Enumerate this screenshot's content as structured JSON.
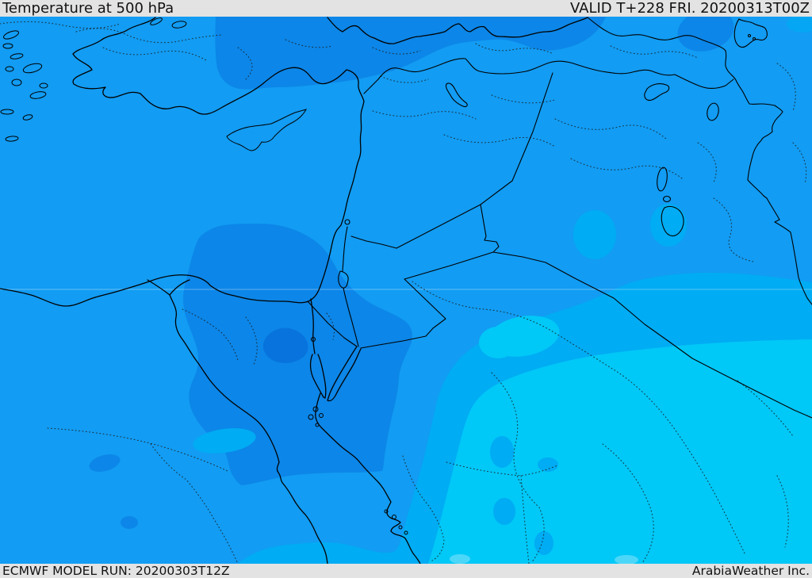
{
  "header": {
    "title": "Temperature at 500 hPa",
    "valid": "VALID T+228 FRI. 20200313T00Z"
  },
  "footer": {
    "model_run": "ECMWF MODEL RUN: 20200303T12Z",
    "attribution": "ArabiaWeather Inc."
  },
  "map": {
    "type": "weather-temperature-contour-map",
    "region": "Middle East / Eastern Mediterranean",
    "palette": {
      "bar_bg": "#e3e3e3",
      "bar_text": "#121212",
      "band_coldest": "#0873dc",
      "band_colder": "#0c86e8",
      "band_cold": "#129cf3",
      "band_mild": "#00acf3",
      "band_milder": "#00c8f7",
      "band_warmest": "#4cd7f9",
      "coastline": "#000000",
      "admin_boundary": "#1c1c1c",
      "latitude_line": "rgba(255,255,255,0.35)"
    },
    "features": [
      "Turkey",
      "Aegean islands",
      "Cyprus",
      "Syria",
      "Lebanon",
      "Israel",
      "Jordan",
      "Iraq",
      "Iran border",
      "Saudi Arabia",
      "Egypt",
      "Nile River and Delta",
      "Suez Canal",
      "Gulf of Suez",
      "Gulf of Aqaba",
      "Red Sea coast",
      "Dead Sea",
      "Sea of Galilee",
      "Lake Tuz",
      "Lake Van",
      "Lake Urmia",
      "Lake Tharthar",
      "Lake Razzaza",
      "Black Sea coast"
    ]
  }
}
